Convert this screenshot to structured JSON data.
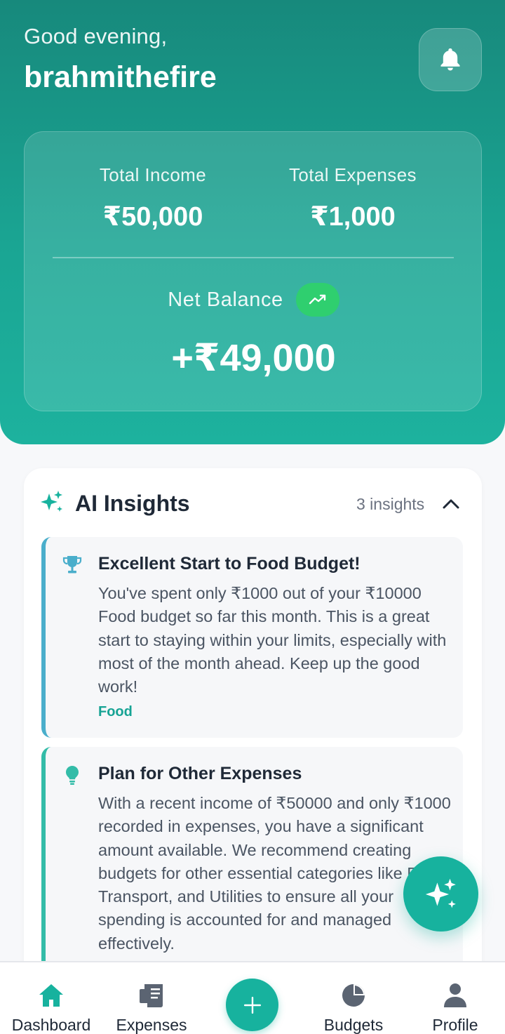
{
  "header": {
    "greeting": "Good evening,",
    "username": "brahmithefire",
    "notification_icon": "bell-icon"
  },
  "summary": {
    "income_label": "Total Income",
    "income_value": "₹50,000",
    "expenses_label": "Total Expenses",
    "expenses_value": "₹1,000",
    "net_label": "Net Balance",
    "net_trend_icon": "trending-up-icon",
    "net_value": "+₹49,000"
  },
  "insights": {
    "title": "AI Insights",
    "count_label": "3 insights",
    "items": [
      {
        "icon": "trophy-icon",
        "title": "Excellent Start to Food Budget!",
        "text": "You've spent only ₹1000 out of your ₹10000 Food budget so far this month. This is a great start to staying within your limits, especially with most of the month ahead. Keep up the good work!",
        "tag": "Food"
      },
      {
        "icon": "lightbulb-icon",
        "title": "Plan for Other Expenses",
        "text": "With a recent income of ₹50000 and only ₹1000 recorded in expenses, you have a significant amount available. We recommend creating budgets for other essential categories like Rent, Transport, and Utilities to ensure all your spending is accounted for and managed effectively."
      }
    ]
  },
  "nav": {
    "dashboard": "Dashboard",
    "expenses": "Expenses",
    "budgets": "Budgets",
    "profile": "Profile"
  },
  "colors": {
    "primary": "#17b29e",
    "header_top": "#17897c",
    "trend_badge": "#2fcf6f",
    "insight_accent_1": "#4aaecb",
    "insight_accent_2": "#33bca8"
  }
}
